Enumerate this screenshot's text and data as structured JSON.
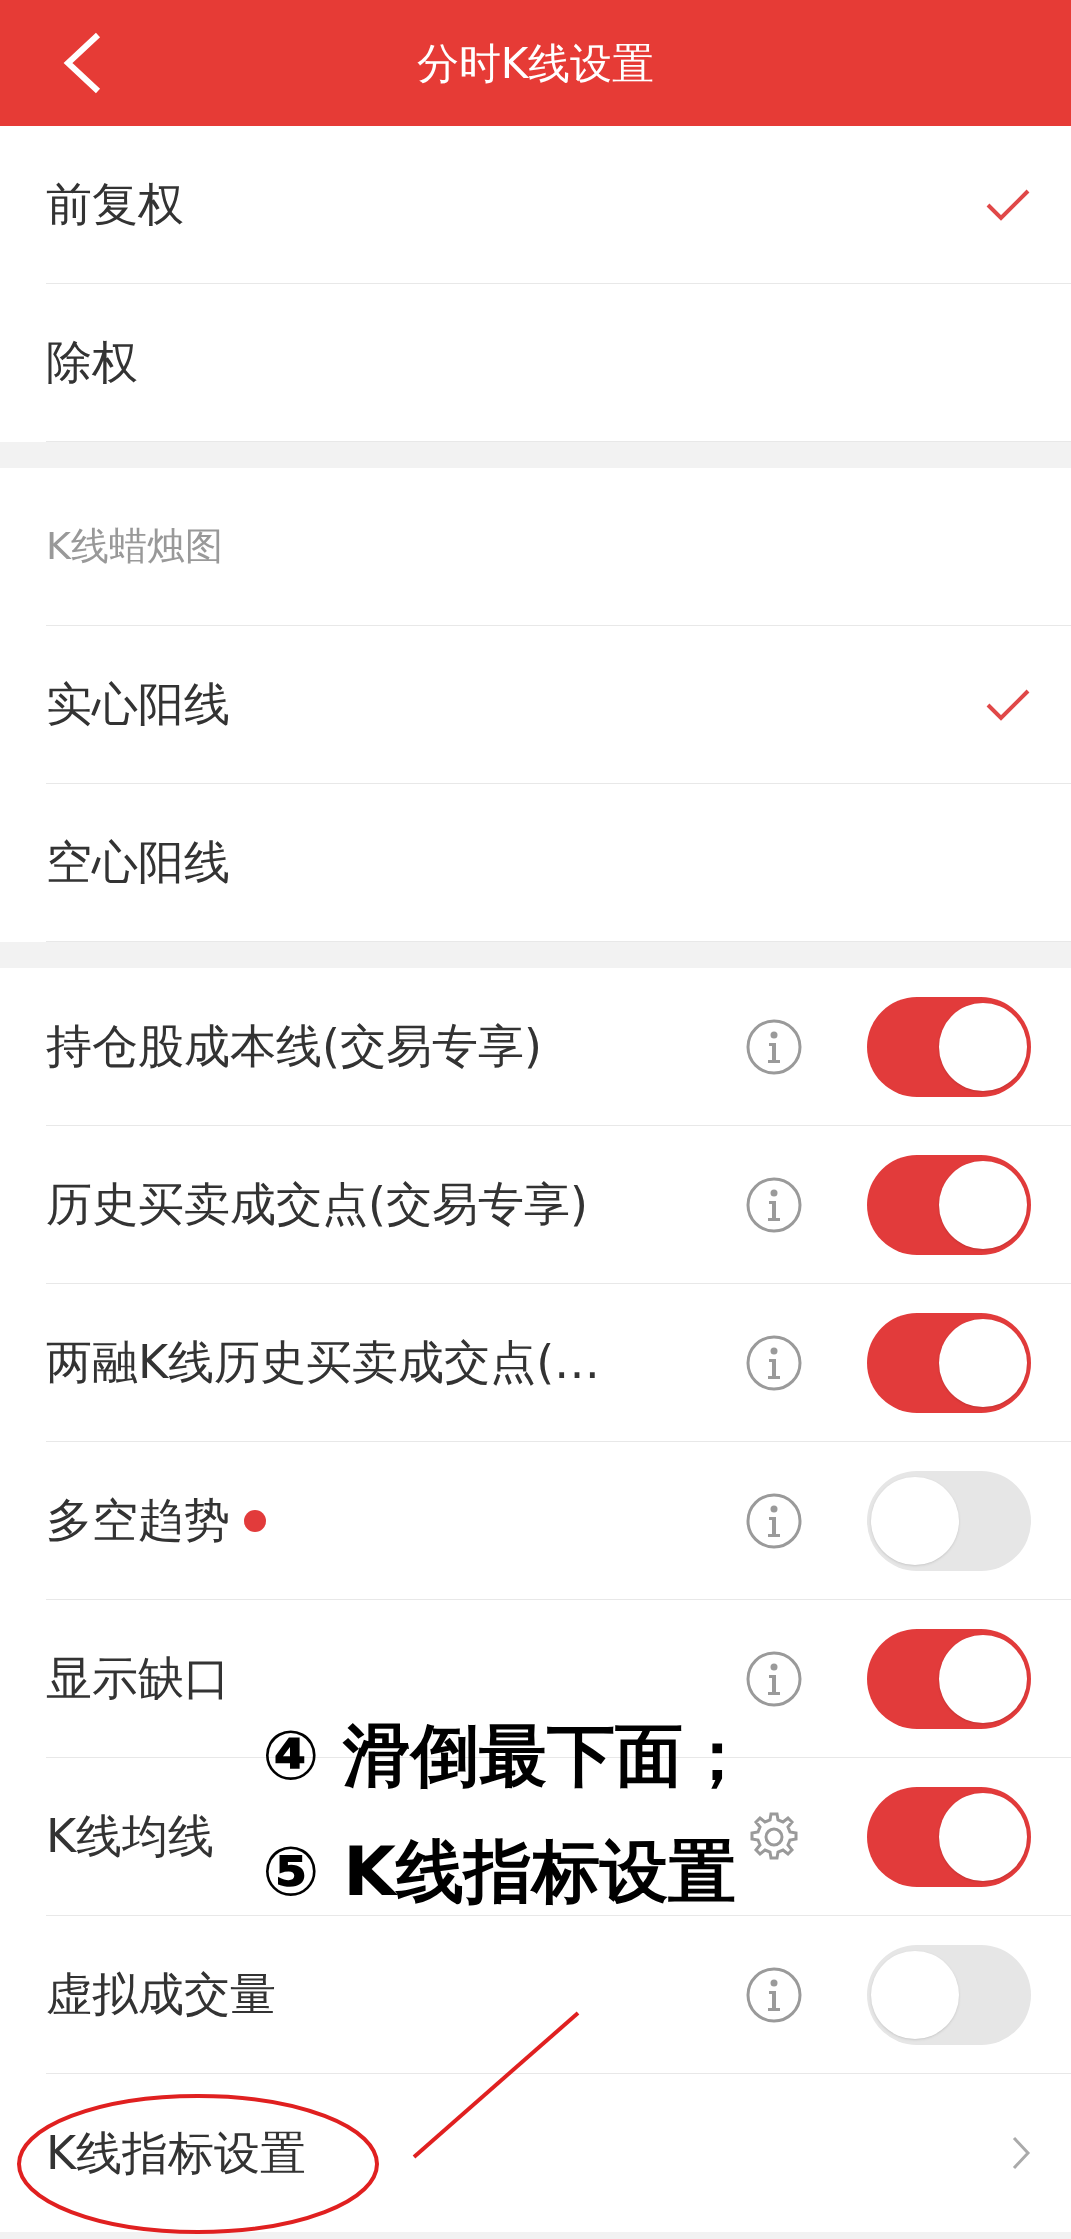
{
  "header": {
    "title": "分时K线设置"
  },
  "sections": [
    {
      "items": [
        {
          "kind": "check",
          "label": "前复权",
          "selected": true
        },
        {
          "kind": "check",
          "label": "除权",
          "selected": false
        }
      ]
    },
    {
      "heading": "K线蜡烛图",
      "items": [
        {
          "kind": "check",
          "label": "实心阳线",
          "selected": true
        },
        {
          "kind": "check",
          "label": "空心阳线",
          "selected": false
        }
      ]
    },
    {
      "items": [
        {
          "kind": "toggle",
          "label": "持仓股成本线(交易专享)",
          "gear": false,
          "badge": false,
          "on": true
        },
        {
          "kind": "toggle",
          "label": "历史买卖成交点(交易专享)",
          "gear": false,
          "badge": false,
          "on": true
        },
        {
          "kind": "toggle",
          "label": "两融K线历史买卖成交点(…",
          "gear": false,
          "badge": false,
          "on": true
        },
        {
          "kind": "toggle",
          "label": "多空趋势",
          "gear": false,
          "badge": true,
          "on": false
        },
        {
          "kind": "toggle",
          "label": "显示缺口",
          "gear": false,
          "badge": false,
          "on": true
        },
        {
          "kind": "toggle",
          "label": "K线均线",
          "gear": true,
          "badge": false,
          "on": true
        },
        {
          "kind": "toggle",
          "label": "虚拟成交量",
          "gear": false,
          "badge": false,
          "on": false
        },
        {
          "kind": "link",
          "label": "K线指标设置"
        }
      ]
    }
  ],
  "annotations": [
    "④ 滑倒最下面；",
    "⑤ K线指标设置"
  ]
}
